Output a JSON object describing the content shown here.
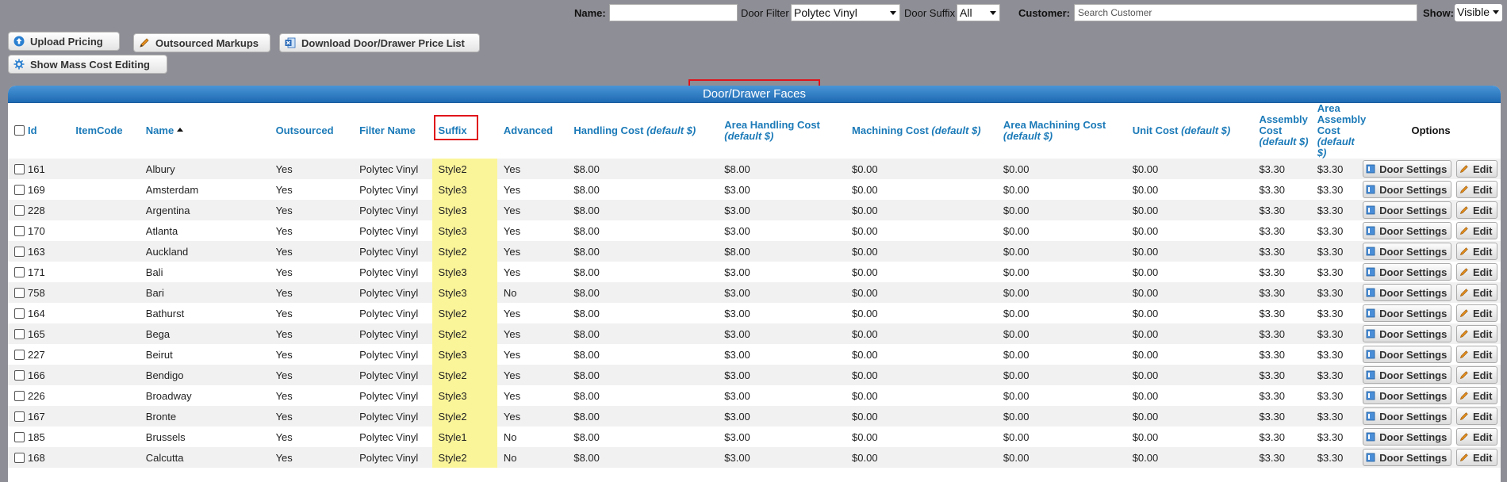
{
  "filters": {
    "name_label": "Name:",
    "name_value": "",
    "door_filter_label": "Door Filter",
    "door_filter_value": "Polytec Vinyl",
    "door_suffix_label": "Door Suffix",
    "door_suffix_value": "All",
    "customer_label": "Customer:",
    "customer_placeholder": "Search Customer",
    "show_label": "Show:",
    "show_value": "Visible"
  },
  "actions": {
    "upload_pricing": "Upload Pricing",
    "outsourced_markups": "Outsourced Markups",
    "download_price_list": "Download Door/Drawer Price List",
    "mass_cost_editing": "Show Mass Cost Editing"
  },
  "panel": {
    "title": "Door/Drawer Faces"
  },
  "columns": {
    "id": "Id",
    "itemcode": "ItemCode",
    "name": "Name",
    "outsourced": "Outsourced",
    "filter_name": "Filter Name",
    "suffix": "Suffix",
    "advanced": "Advanced",
    "handling_cost": "Handling Cost",
    "area_handling_cost": "Area Handling Cost",
    "machining_cost": "Machining Cost",
    "area_machining_cost": "Area Machining Cost",
    "unit_cost": "Unit Cost",
    "assembly_cost": "Assembly Cost",
    "area_assembly_cost": "Area Assembly Cost",
    "default_tag": "(default $)",
    "options": "Options"
  },
  "row_buttons": {
    "door_settings": "Door Settings",
    "edit": "Edit"
  },
  "rows": [
    {
      "id": "161",
      "itemcode": "",
      "name": "Albury",
      "outsourced": "Yes",
      "filter": "Polytec Vinyl",
      "suffix": "Style2",
      "advanced": "Yes",
      "handling": "$8.00",
      "area_handling": "$8.00",
      "machining": "$0.00",
      "area_machining": "$0.00",
      "unit": "$0.00",
      "assembly": "$3.30",
      "area_assembly": "$3.30"
    },
    {
      "id": "169",
      "itemcode": "",
      "name": "Amsterdam",
      "outsourced": "Yes",
      "filter": "Polytec Vinyl",
      "suffix": "Style3",
      "advanced": "Yes",
      "handling": "$8.00",
      "area_handling": "$3.00",
      "machining": "$0.00",
      "area_machining": "$0.00",
      "unit": "$0.00",
      "assembly": "$3.30",
      "area_assembly": "$3.30"
    },
    {
      "id": "228",
      "itemcode": "",
      "name": "Argentina",
      "outsourced": "Yes",
      "filter": "Polytec Vinyl",
      "suffix": "Style3",
      "advanced": "Yes",
      "handling": "$8.00",
      "area_handling": "$3.00",
      "machining": "$0.00",
      "area_machining": "$0.00",
      "unit": "$0.00",
      "assembly": "$3.30",
      "area_assembly": "$3.30"
    },
    {
      "id": "170",
      "itemcode": "",
      "name": "Atlanta",
      "outsourced": "Yes",
      "filter": "Polytec Vinyl",
      "suffix": "Style3",
      "advanced": "Yes",
      "handling": "$8.00",
      "area_handling": "$3.00",
      "machining": "$0.00",
      "area_machining": "$0.00",
      "unit": "$0.00",
      "assembly": "$3.30",
      "area_assembly": "$3.30"
    },
    {
      "id": "163",
      "itemcode": "",
      "name": "Auckland",
      "outsourced": "Yes",
      "filter": "Polytec Vinyl",
      "suffix": "Style2",
      "advanced": "Yes",
      "handling": "$8.00",
      "area_handling": "$8.00",
      "machining": "$0.00",
      "area_machining": "$0.00",
      "unit": "$0.00",
      "assembly": "$3.30",
      "area_assembly": "$3.30"
    },
    {
      "id": "171",
      "itemcode": "",
      "name": "Bali",
      "outsourced": "Yes",
      "filter": "Polytec Vinyl",
      "suffix": "Style3",
      "advanced": "Yes",
      "handling": "$8.00",
      "area_handling": "$3.00",
      "machining": "$0.00",
      "area_machining": "$0.00",
      "unit": "$0.00",
      "assembly": "$3.30",
      "area_assembly": "$3.30"
    },
    {
      "id": "758",
      "itemcode": "",
      "name": "Bari",
      "outsourced": "Yes",
      "filter": "Polytec Vinyl",
      "suffix": "Style3",
      "advanced": "No",
      "handling": "$8.00",
      "area_handling": "$3.00",
      "machining": "$0.00",
      "area_machining": "$0.00",
      "unit": "$0.00",
      "assembly": "$3.30",
      "area_assembly": "$3.30"
    },
    {
      "id": "164",
      "itemcode": "",
      "name": "Bathurst",
      "outsourced": "Yes",
      "filter": "Polytec Vinyl",
      "suffix": "Style2",
      "advanced": "Yes",
      "handling": "$8.00",
      "area_handling": "$3.00",
      "machining": "$0.00",
      "area_machining": "$0.00",
      "unit": "$0.00",
      "assembly": "$3.30",
      "area_assembly": "$3.30"
    },
    {
      "id": "165",
      "itemcode": "",
      "name": "Bega",
      "outsourced": "Yes",
      "filter": "Polytec Vinyl",
      "suffix": "Style2",
      "advanced": "Yes",
      "handling": "$8.00",
      "area_handling": "$3.00",
      "machining": "$0.00",
      "area_machining": "$0.00",
      "unit": "$0.00",
      "assembly": "$3.30",
      "area_assembly": "$3.30"
    },
    {
      "id": "227",
      "itemcode": "",
      "name": "Beirut",
      "outsourced": "Yes",
      "filter": "Polytec Vinyl",
      "suffix": "Style3",
      "advanced": "Yes",
      "handling": "$8.00",
      "area_handling": "$3.00",
      "machining": "$0.00",
      "area_machining": "$0.00",
      "unit": "$0.00",
      "assembly": "$3.30",
      "area_assembly": "$3.30"
    },
    {
      "id": "166",
      "itemcode": "",
      "name": "Bendigo",
      "outsourced": "Yes",
      "filter": "Polytec Vinyl",
      "suffix": "Style2",
      "advanced": "Yes",
      "handling": "$8.00",
      "area_handling": "$3.00",
      "machining": "$0.00",
      "area_machining": "$0.00",
      "unit": "$0.00",
      "assembly": "$3.30",
      "area_assembly": "$3.30"
    },
    {
      "id": "226",
      "itemcode": "",
      "name": "Broadway",
      "outsourced": "Yes",
      "filter": "Polytec Vinyl",
      "suffix": "Style3",
      "advanced": "Yes",
      "handling": "$8.00",
      "area_handling": "$3.00",
      "machining": "$0.00",
      "area_machining": "$0.00",
      "unit": "$0.00",
      "assembly": "$3.30",
      "area_assembly": "$3.30"
    },
    {
      "id": "167",
      "itemcode": "",
      "name": "Bronte",
      "outsourced": "Yes",
      "filter": "Polytec Vinyl",
      "suffix": "Style2",
      "advanced": "Yes",
      "handling": "$8.00",
      "area_handling": "$3.00",
      "machining": "$0.00",
      "area_machining": "$0.00",
      "unit": "$0.00",
      "assembly": "$3.30",
      "area_assembly": "$3.30"
    },
    {
      "id": "185",
      "itemcode": "",
      "name": "Brussels",
      "outsourced": "Yes",
      "filter": "Polytec Vinyl",
      "suffix": "Style1",
      "advanced": "No",
      "handling": "$8.00",
      "area_handling": "$3.00",
      "machining": "$0.00",
      "area_machining": "$0.00",
      "unit": "$0.00",
      "assembly": "$3.30",
      "area_assembly": "$3.30"
    },
    {
      "id": "168",
      "itemcode": "",
      "name": "Calcutta",
      "outsourced": "Yes",
      "filter": "Polytec Vinyl",
      "suffix": "Style2",
      "advanced": "No",
      "handling": "$8.00",
      "area_handling": "$3.00",
      "machining": "$0.00",
      "area_machining": "$0.00",
      "unit": "$0.00",
      "assembly": "$3.30",
      "area_assembly": "$3.30"
    }
  ]
}
